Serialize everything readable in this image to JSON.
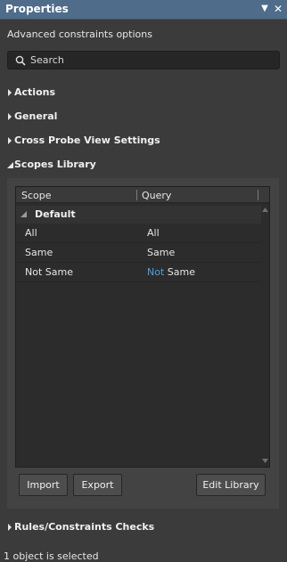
{
  "window": {
    "title": "Properties"
  },
  "panel": {
    "subtitle": "Advanced constraints options",
    "search": {
      "placeholder": "Search",
      "value": ""
    }
  },
  "sections": {
    "actions": "Actions",
    "general": "General",
    "cross_probe": "Cross Probe View Settings",
    "scopes_library": "Scopes Library",
    "rules_checks": "Rules/Constraints Checks"
  },
  "scopes_table": {
    "columns": [
      "Scope",
      "Query"
    ],
    "group": "Default",
    "rows": [
      {
        "scope": "All",
        "query_keyword": "",
        "query": "All"
      },
      {
        "scope": "Same",
        "query_keyword": "",
        "query": "Same"
      },
      {
        "scope": "Not Same",
        "query_keyword": "Not",
        "query": " Same"
      }
    ]
  },
  "buttons": {
    "import": "Import",
    "export": "Export",
    "edit_library": "Edit Library"
  },
  "status": "1 object is selected",
  "colors": {
    "titlebar": "#4f6c8a",
    "keyword": "#4aa3e0",
    "background": "#3b3b3b"
  },
  "icons": [
    "dropdown-arrow-icon",
    "close-icon",
    "search-icon",
    "expand-caret-icon",
    "collapse-caret-icon",
    "scroll-up-icon",
    "scroll-down-icon"
  ]
}
